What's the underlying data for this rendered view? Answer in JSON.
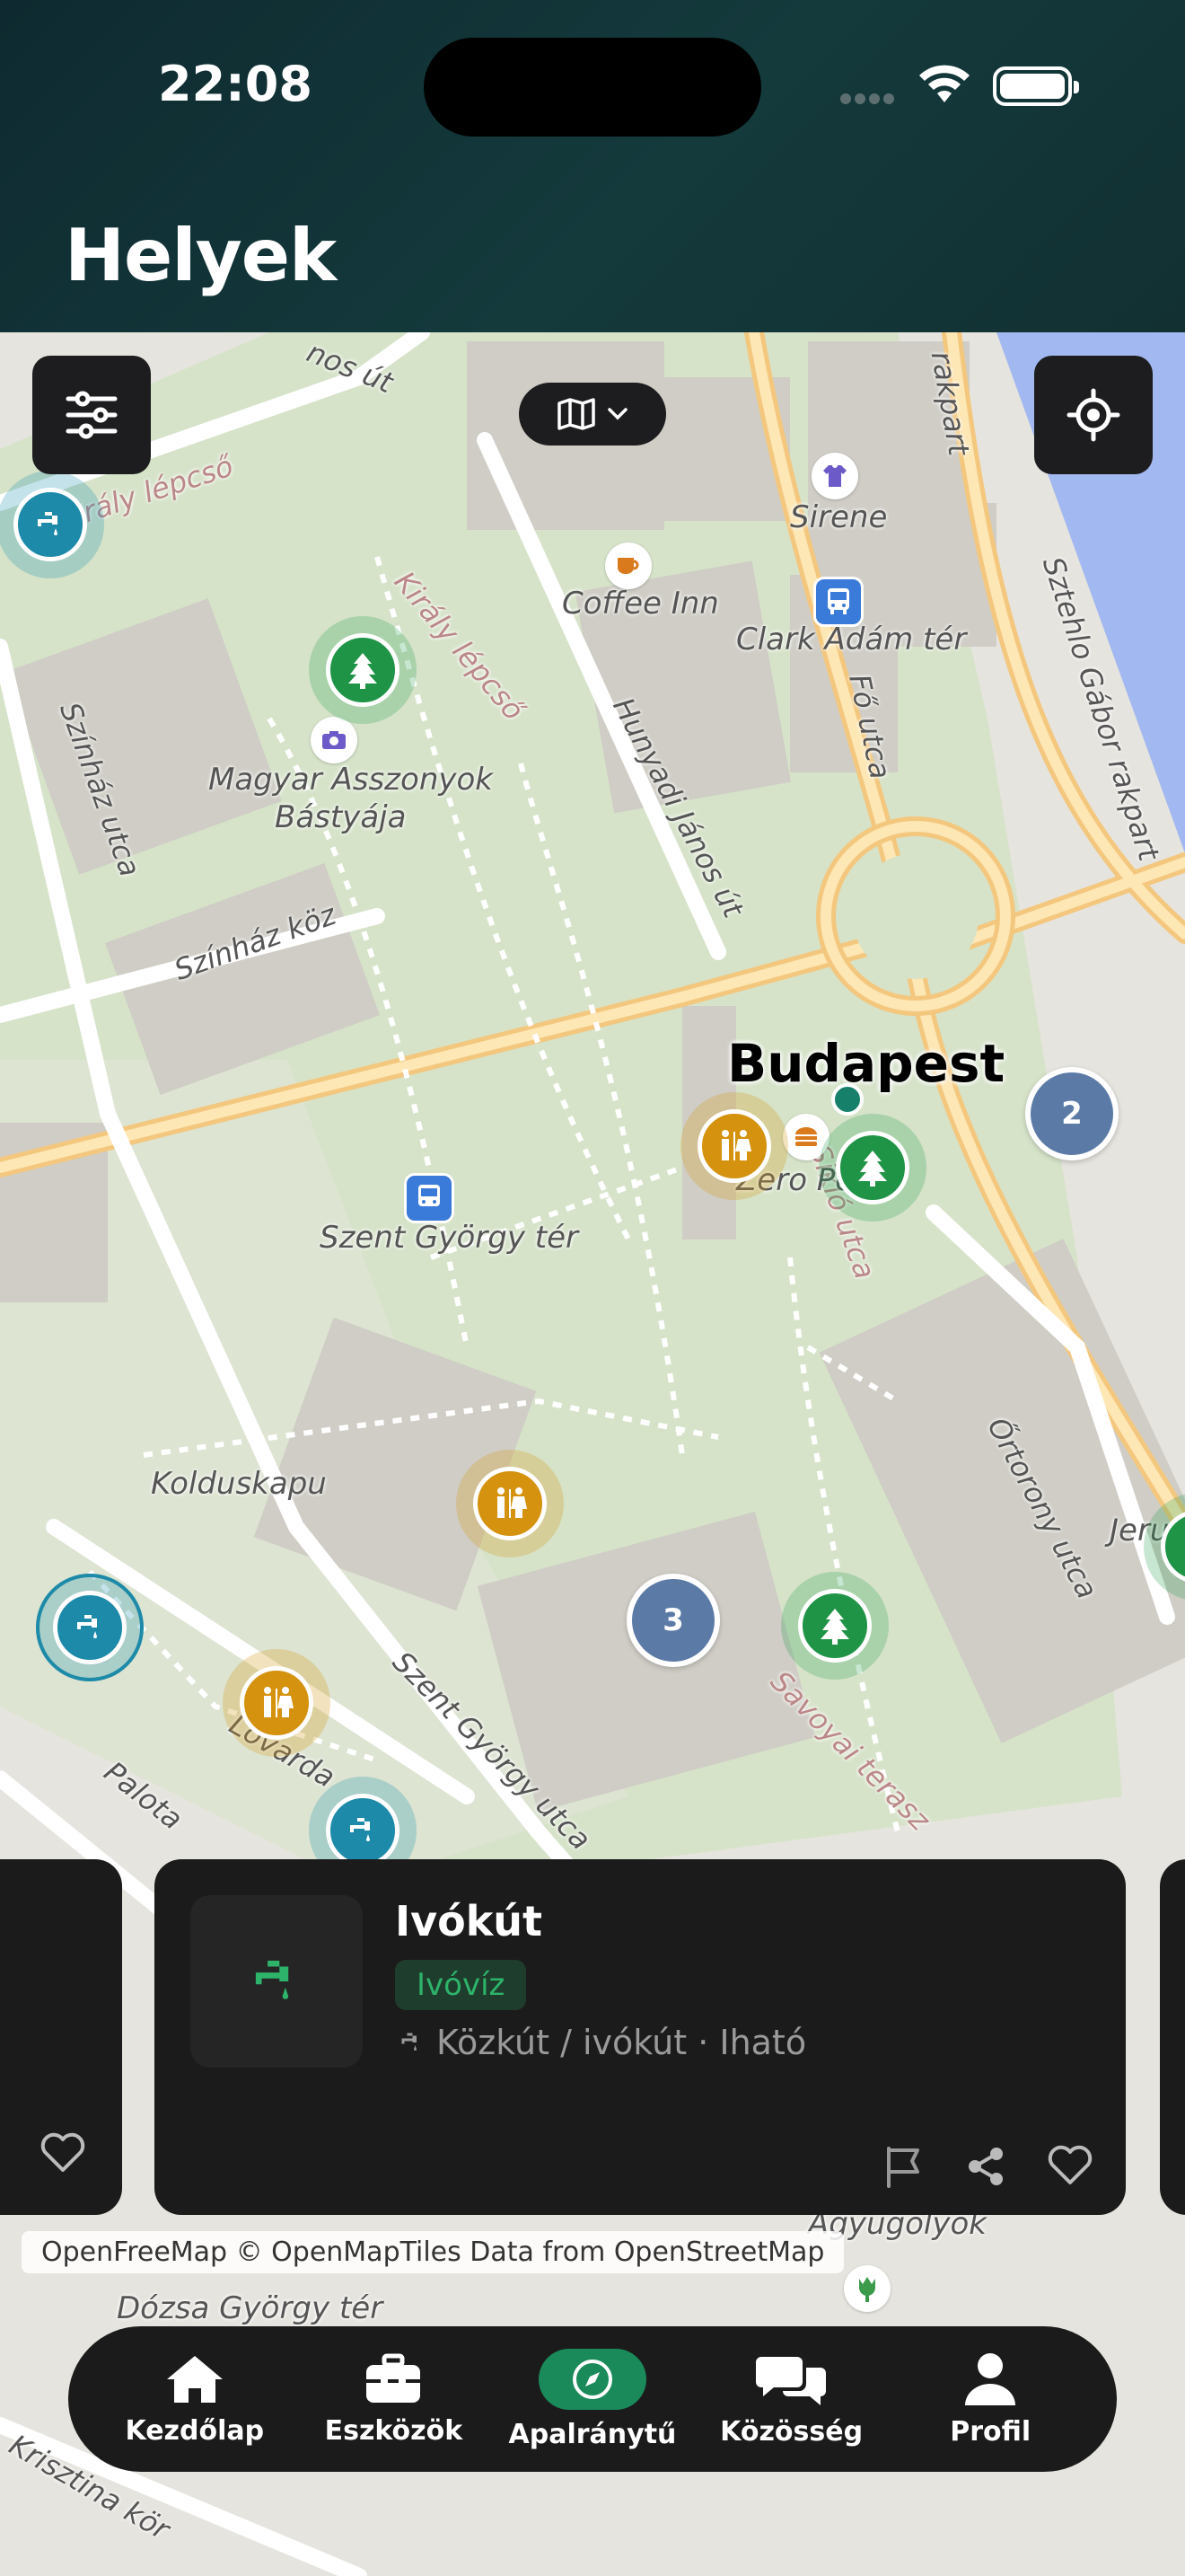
{
  "status": {
    "time": "22:08"
  },
  "header": {
    "title": "Helyek"
  },
  "map": {
    "city": "Budapest",
    "labels": {
      "sirene": "Sirene",
      "coffee_inn": "Coffee Inn",
      "clark_adam_ter": "Clark Ádám tér",
      "magyar_asszonyok": "Magyar Asszonyok",
      "bastyaja": "Bástyája",
      "zero_point": "Zero Po",
      "szent_gyorgy_ter": "Szent György tér",
      "kolduskapu": "Kolduskapu",
      "jeruzs": "Jeruzs",
      "agyugolyok": "Agyugolyok",
      "dozsa_gyorgy": "Dózsa György tér"
    },
    "streets": {
      "kiraly_lepcso": "Király lépcső",
      "kiraly_lepcso2": "Király lépcső",
      "szinhaz_utca": "Színház utca",
      "szinhaz_koz": "Színház köz",
      "hunyadi": "Hunyadi János út",
      "fo_utca": "Fő utca",
      "szhg_rakpart": "Sztehlo Gábor rakpart",
      "siklo_utca": "Sikló utca",
      "ortorhaz": "Őrtorony utca",
      "szent_gyorgy_utca": "Szent György utca",
      "savoyai": "Savoyai terasz",
      "lovarda": "Lovarda",
      "palota": "Palota",
      "krisztina": "Krisztina kör",
      "rakpart_top": "rakpart",
      "janos_ut": "nos út"
    },
    "clusters": [
      "2",
      "3"
    ],
    "attribution": "OpenFreeMap © OpenMapTiles Data from OpenStreetMap"
  },
  "card": {
    "title": "Ivókút",
    "tag": "Ivóvíz",
    "meta": "Közkút / ivókút · Iható"
  },
  "tabbar": {
    "items": [
      {
        "label": "Kezdőlap",
        "icon": "home-icon"
      },
      {
        "label": "Eszközök",
        "icon": "toolbox-icon"
      },
      {
        "label": "Apalránytű",
        "icon": "compass-icon"
      },
      {
        "label": "Közösség",
        "icon": "chat-icon"
      },
      {
        "label": "Profil",
        "icon": "person-icon"
      }
    ],
    "active_color": "#1a8a5a"
  },
  "colors": {
    "water_marker": "#1c8aa8",
    "park_marker": "#1f9447",
    "toilet_marker": "#d4920f",
    "cluster": "#5b7ba6"
  }
}
